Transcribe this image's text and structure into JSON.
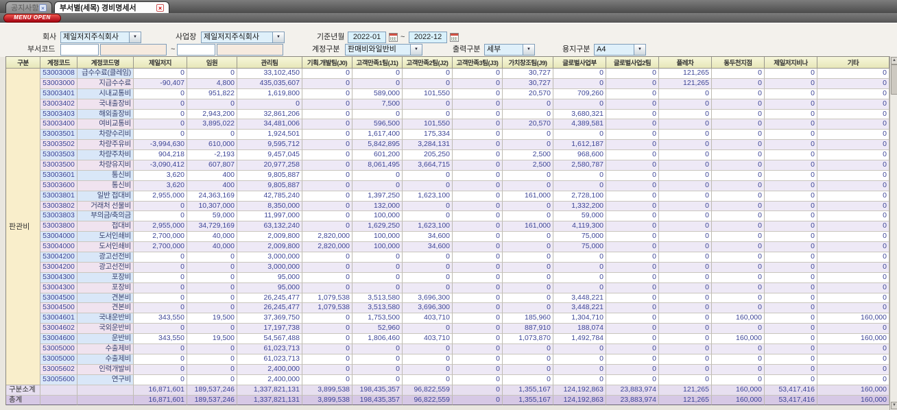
{
  "tabs": [
    {
      "label": "공지사항",
      "active": false
    },
    {
      "label": "부서별(세목) 경비명세서",
      "active": true
    }
  ],
  "menu_button_label": "MENU OPEN",
  "form": {
    "company_label": "회사",
    "company_value": "제일저지주식회사",
    "workplace_label": "사업장",
    "workplace_value": "제일저지주식회사",
    "period_label": "기준년월",
    "period_from": "2022-01",
    "period_to": "2022-12",
    "range_separator": "~",
    "dept_code_label": "부서코드",
    "account_type_label": "계정구분",
    "account_type_value": "판매비와일반비",
    "output_type_label": "출력구분",
    "output_type_value": "세부",
    "paper_type_label": "용지구분",
    "paper_type_value": "A4"
  },
  "colors": {
    "menu_button_red": "#b30000",
    "header_yellow": "#ededc6",
    "group_cell_cream": "#f9eecb",
    "odd_key_blue": "#d9e7f8",
    "even_key_pink": "#f0e3ef",
    "even_num_lavender": "#eee9f6",
    "subtotal_purple": "#e7dff0",
    "total_purple": "#d6c8e5",
    "number_text_blue": "#3c4496"
  },
  "table": {
    "headers": [
      "구분",
      "계정코드",
      "계정코드명",
      "제일저지",
      "임원",
      "관리팀",
      "기획.개발팀(J0)",
      "고객만족1팀(J1)",
      "고객만족2팀(J2)",
      "고객만족3팀(J3)",
      "가치창조팀(J9)",
      "글로벌사업부",
      "글로벌사업2팀",
      "플레차",
      "동두천지점",
      "제일저지비나",
      "기타"
    ],
    "group_label": "판관비",
    "rows": [
      {
        "code": "53003008",
        "name": "급수수료(클레임)",
        "values": [
          "0",
          "0",
          "33,102,450",
          "0",
          "0",
          "0",
          "0",
          "30,727",
          "0",
          "0",
          "121,265",
          "0",
          "0",
          "0"
        ]
      },
      {
        "code": "53003000",
        "name": "지급수수료",
        "values": [
          "-90,407",
          "4,800",
          "435,035,607",
          "0",
          "0",
          "0",
          "0",
          "30,727",
          "0",
          "0",
          "121,265",
          "0",
          "0",
          "0"
        ]
      },
      {
        "code": "53003401",
        "name": "시내교통비",
        "values": [
          "0",
          "951,822",
          "1,619,800",
          "0",
          "589,000",
          "101,550",
          "0",
          "20,570",
          "709,260",
          "0",
          "0",
          "0",
          "0",
          "0"
        ]
      },
      {
        "code": "53003402",
        "name": "국내출장비",
        "values": [
          "0",
          "0",
          "0",
          "0",
          "7,500",
          "0",
          "0",
          "0",
          "0",
          "0",
          "0",
          "0",
          "0",
          "0"
        ]
      },
      {
        "code": "53003403",
        "name": "해외출장비",
        "values": [
          "0",
          "2,943,200",
          "32,861,206",
          "0",
          "0",
          "0",
          "0",
          "0",
          "3,680,321",
          "0",
          "0",
          "0",
          "0",
          "0"
        ]
      },
      {
        "code": "53003400",
        "name": "여비교통비",
        "values": [
          "0",
          "3,895,022",
          "34,481,006",
          "0",
          "596,500",
          "101,550",
          "0",
          "20,570",
          "4,389,581",
          "0",
          "0",
          "0",
          "0",
          "0"
        ]
      },
      {
        "code": "53003501",
        "name": "차량수리비",
        "values": [
          "0",
          "0",
          "1,924,501",
          "0",
          "1,617,400",
          "175,334",
          "0",
          "0",
          "0",
          "0",
          "0",
          "0",
          "0",
          "0"
        ]
      },
      {
        "code": "53003502",
        "name": "차량주유비",
        "values": [
          "-3,994,630",
          "610,000",
          "9,595,712",
          "0",
          "5,842,895",
          "3,284,131",
          "0",
          "0",
          "1,612,187",
          "0",
          "0",
          "0",
          "0",
          "0"
        ]
      },
      {
        "code": "53003503",
        "name": "차량주차비",
        "values": [
          "904,218",
          "-2,193",
          "9,457,045",
          "0",
          "601,200",
          "205,250",
          "0",
          "2,500",
          "968,600",
          "0",
          "0",
          "0",
          "0",
          "0"
        ]
      },
      {
        "code": "53003500",
        "name": "차량유지비",
        "values": [
          "-3,090,412",
          "607,807",
          "20,977,258",
          "0",
          "8,061,495",
          "3,664,715",
          "0",
          "2,500",
          "2,580,787",
          "0",
          "0",
          "0",
          "0",
          "0"
        ]
      },
      {
        "code": "53003601",
        "name": "통신비",
        "values": [
          "3,620",
          "400",
          "9,805,887",
          "0",
          "0",
          "0",
          "0",
          "0",
          "0",
          "0",
          "0",
          "0",
          "0",
          "0"
        ]
      },
      {
        "code": "53003600",
        "name": "통신비",
        "values": [
          "3,620",
          "400",
          "9,805,887",
          "0",
          "0",
          "0",
          "0",
          "0",
          "0",
          "0",
          "0",
          "0",
          "0",
          "0"
        ]
      },
      {
        "code": "53003801",
        "name": "일반 접대비",
        "values": [
          "2,955,000",
          "24,363,169",
          "42,785,240",
          "0",
          "1,397,250",
          "1,623,100",
          "0",
          "161,000",
          "2,728,100",
          "0",
          "0",
          "0",
          "0",
          "0"
        ]
      },
      {
        "code": "53003802",
        "name": "거래처 선물비",
        "values": [
          "0",
          "10,307,000",
          "8,350,000",
          "0",
          "132,000",
          "0",
          "0",
          "0",
          "1,332,200",
          "0",
          "0",
          "0",
          "0",
          "0"
        ]
      },
      {
        "code": "53003803",
        "name": "부의금/축의금",
        "values": [
          "0",
          "59,000",
          "11,997,000",
          "0",
          "100,000",
          "0",
          "0",
          "0",
          "59,000",
          "0",
          "0",
          "0",
          "0",
          "0"
        ]
      },
      {
        "code": "53003800",
        "name": "접대비",
        "values": [
          "2,955,000",
          "34,729,169",
          "63,132,240",
          "0",
          "1,629,250",
          "1,623,100",
          "0",
          "161,000",
          "4,119,300",
          "0",
          "0",
          "0",
          "0",
          "0"
        ]
      },
      {
        "code": "53004000",
        "name": "도서인쇄비",
        "values": [
          "2,700,000",
          "40,000",
          "2,009,800",
          "2,820,000",
          "100,000",
          "34,600",
          "0",
          "0",
          "75,000",
          "0",
          "0",
          "0",
          "0",
          "0"
        ]
      },
      {
        "code": "53004000",
        "name": "도서인쇄비",
        "values": [
          "2,700,000",
          "40,000",
          "2,009,800",
          "2,820,000",
          "100,000",
          "34,600",
          "0",
          "0",
          "75,000",
          "0",
          "0",
          "0",
          "0",
          "0"
        ]
      },
      {
        "code": "53004200",
        "name": "광고선전비",
        "values": [
          "0",
          "0",
          "3,000,000",
          "0",
          "0",
          "0",
          "0",
          "0",
          "0",
          "0",
          "0",
          "0",
          "0",
          "0"
        ]
      },
      {
        "code": "53004200",
        "name": "광고선전비",
        "values": [
          "0",
          "0",
          "3,000,000",
          "0",
          "0",
          "0",
          "0",
          "0",
          "0",
          "0",
          "0",
          "0",
          "0",
          "0"
        ]
      },
      {
        "code": "53004300",
        "name": "포장비",
        "values": [
          "0",
          "0",
          "95,000",
          "0",
          "0",
          "0",
          "0",
          "0",
          "0",
          "0",
          "0",
          "0",
          "0",
          "0"
        ]
      },
      {
        "code": "53004300",
        "name": "포장비",
        "values": [
          "0",
          "0",
          "95,000",
          "0",
          "0",
          "0",
          "0",
          "0",
          "0",
          "0",
          "0",
          "0",
          "0",
          "0"
        ]
      },
      {
        "code": "53004500",
        "name": "견본비",
        "values": [
          "0",
          "0",
          "26,245,477",
          "1,079,538",
          "3,513,580",
          "3,696,300",
          "0",
          "0",
          "3,448,221",
          "0",
          "0",
          "0",
          "0",
          "0"
        ]
      },
      {
        "code": "53004500",
        "name": "견본비",
        "values": [
          "0",
          "0",
          "26,245,477",
          "1,079,538",
          "3,513,580",
          "3,696,300",
          "0",
          "0",
          "3,448,221",
          "0",
          "0",
          "0",
          "0",
          "0"
        ]
      },
      {
        "code": "53004601",
        "name": "국내운반비",
        "values": [
          "343,550",
          "19,500",
          "37,369,750",
          "0",
          "1,753,500",
          "403,710",
          "0",
          "185,960",
          "1,304,710",
          "0",
          "0",
          "160,000",
          "0",
          "160,000"
        ]
      },
      {
        "code": "53004602",
        "name": "국외운반비",
        "values": [
          "0",
          "0",
          "17,197,738",
          "0",
          "52,960",
          "0",
          "0",
          "887,910",
          "188,074",
          "0",
          "0",
          "0",
          "0",
          "0"
        ]
      },
      {
        "code": "53004600",
        "name": "운반비",
        "values": [
          "343,550",
          "19,500",
          "54,567,488",
          "0",
          "1,806,460",
          "403,710",
          "0",
          "1,073,870",
          "1,492,784",
          "0",
          "0",
          "160,000",
          "0",
          "160,000"
        ]
      },
      {
        "code": "53005000",
        "name": "수출제비",
        "values": [
          "0",
          "0",
          "61,023,713",
          "0",
          "0",
          "0",
          "0",
          "0",
          "0",
          "0",
          "0",
          "0",
          "0",
          "0"
        ]
      },
      {
        "code": "53005000",
        "name": "수출제비",
        "values": [
          "0",
          "0",
          "61,023,713",
          "0",
          "0",
          "0",
          "0",
          "0",
          "0",
          "0",
          "0",
          "0",
          "0",
          "0"
        ]
      },
      {
        "code": "53005602",
        "name": "인력개발비",
        "values": [
          "0",
          "0",
          "2,400,000",
          "0",
          "0",
          "0",
          "0",
          "0",
          "0",
          "0",
          "0",
          "0",
          "0",
          "0"
        ]
      },
      {
        "code": "53005600",
        "name": "연구비",
        "values": [
          "0",
          "0",
          "2,400,000",
          "0",
          "0",
          "0",
          "0",
          "0",
          "0",
          "0",
          "0",
          "0",
          "0",
          "0"
        ]
      }
    ],
    "subtotal": {
      "label": "구분소계",
      "values": [
        "16,871,601",
        "189,537,246",
        "1,337,821,131",
        "3,899,538",
        "198,435,357",
        "96,822,559",
        "0",
        "1,355,167",
        "124,192,863",
        "23,883,974",
        "121,265",
        "160,000",
        "53,417,416",
        "160,000"
      ]
    },
    "total": {
      "label": "총계",
      "values": [
        "16,871,601",
        "189,537,246",
        "1,337,821,131",
        "3,899,538",
        "198,435,357",
        "96,822,559",
        "0",
        "1,355,167",
        "124,192,863",
        "23,883,974",
        "121,265",
        "160,000",
        "53,417,416",
        "160,000"
      ]
    }
  }
}
